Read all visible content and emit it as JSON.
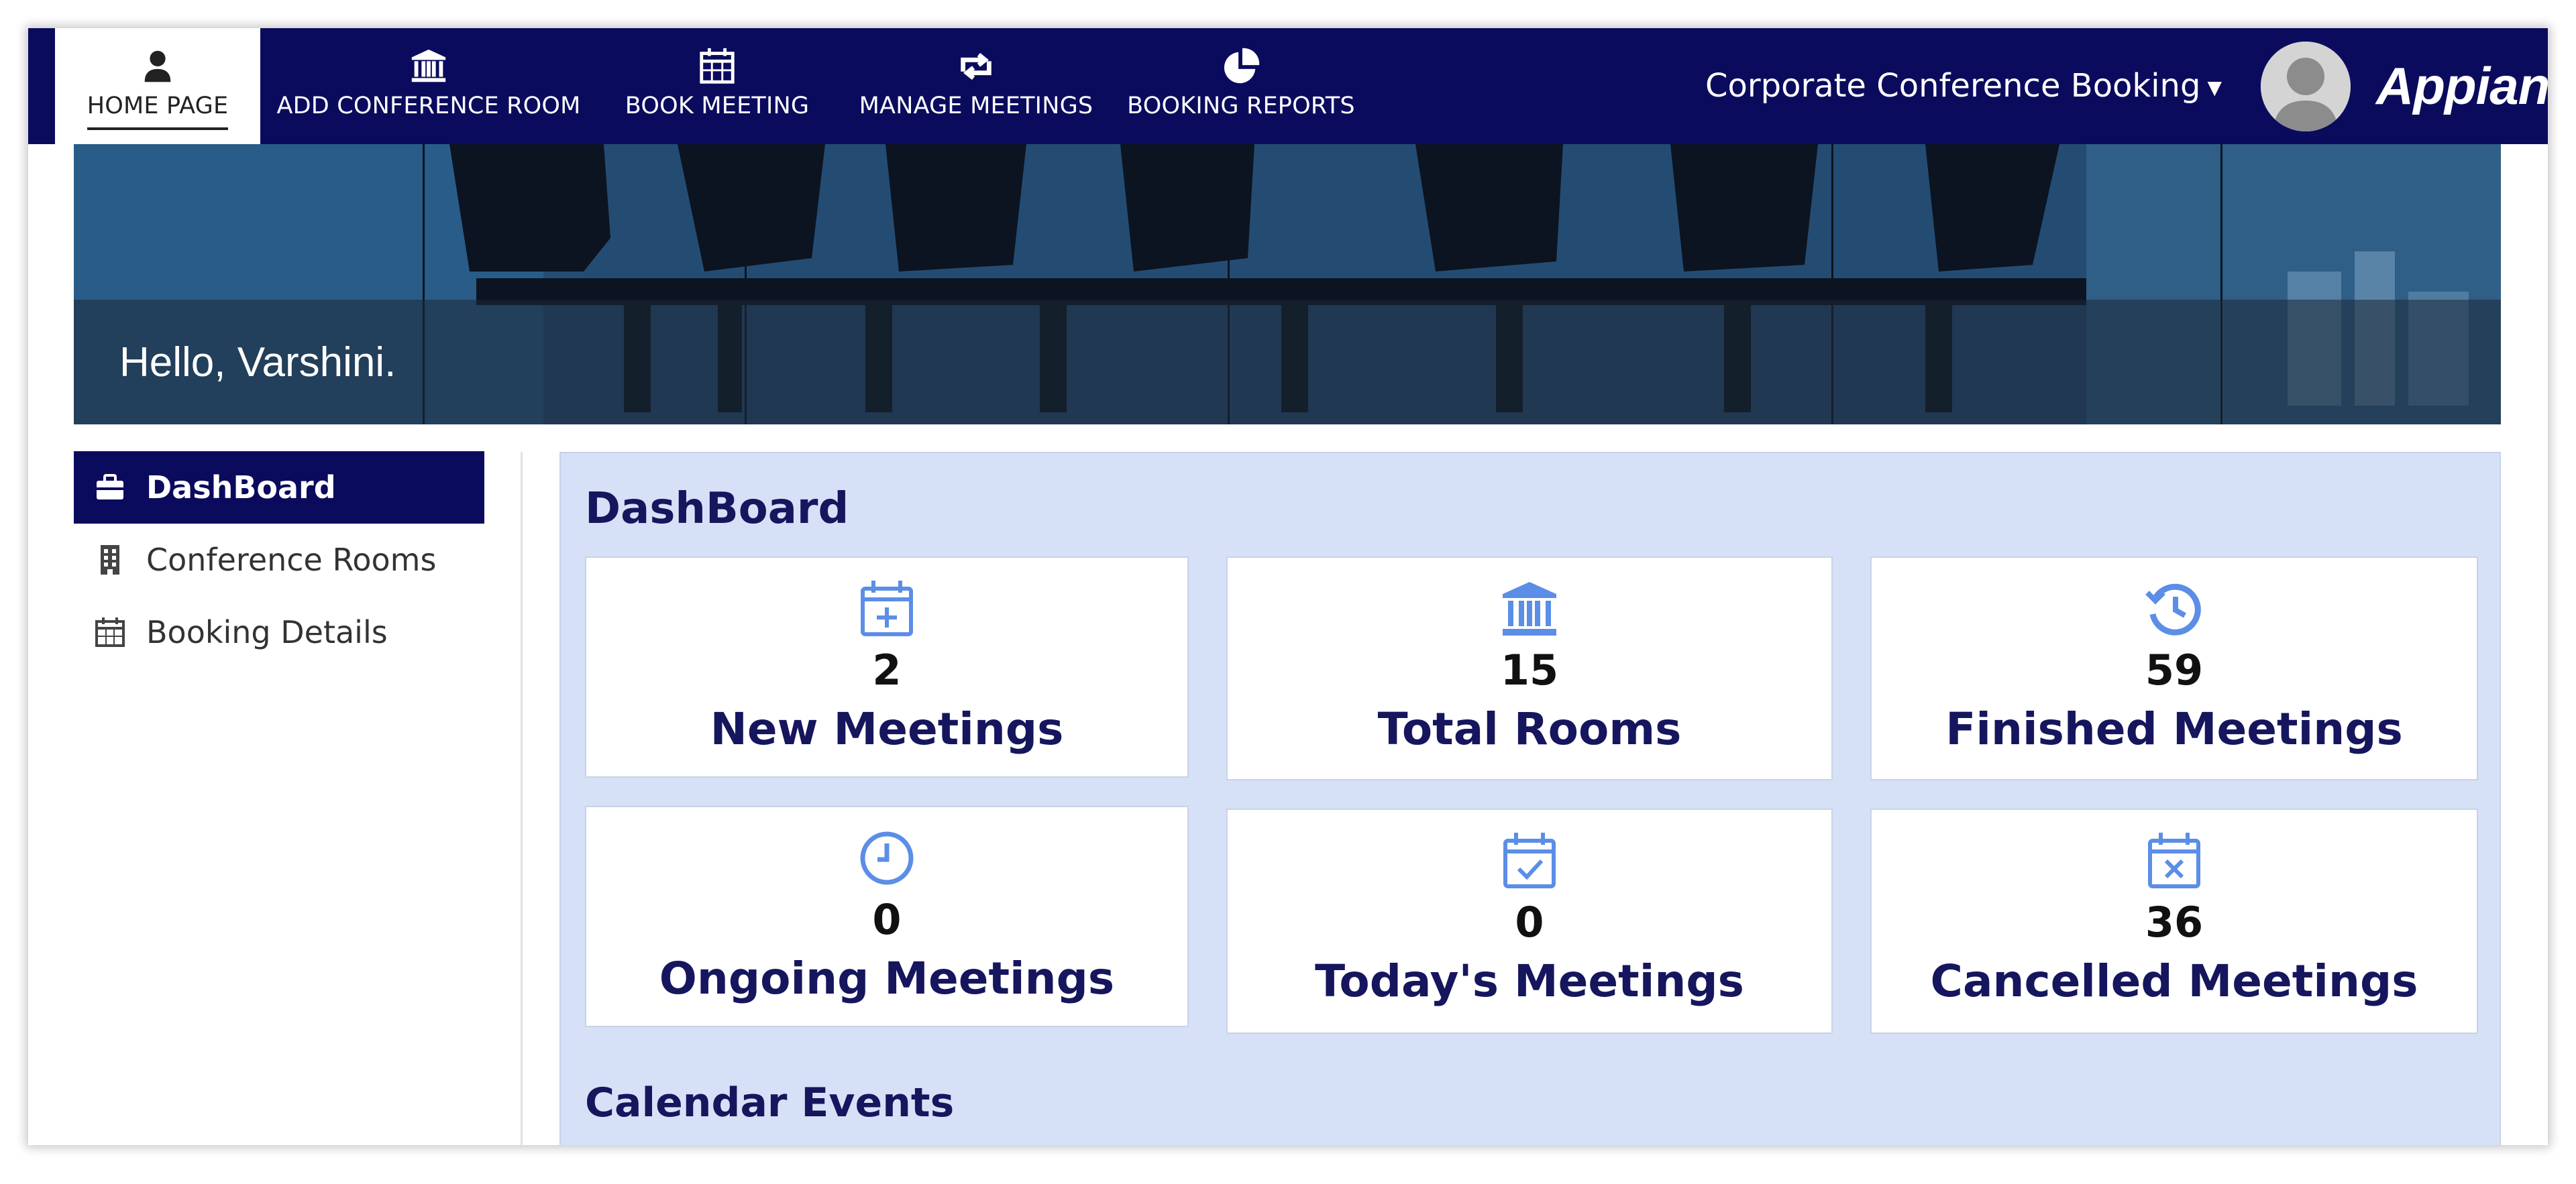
{
  "nav": {
    "tabs": [
      {
        "label": "HOME PAGE",
        "icon": "user-icon",
        "active": true
      },
      {
        "label": "ADD CONFERENCE ROOM",
        "icon": "bank-icon"
      },
      {
        "label": "BOOK MEETING",
        "icon": "calendar-icon"
      },
      {
        "label": "MANAGE MEETINGS",
        "icon": "retweet-icon"
      },
      {
        "label": "BOOKING REPORTS",
        "icon": "pie-chart-icon"
      }
    ],
    "app_name": "Corporate Conference Booking",
    "logo_text": "Appian"
  },
  "banner": {
    "greeting": "Hello, Varshini."
  },
  "sidebar": {
    "items": [
      {
        "label": "DashBoard",
        "icon": "briefcase-icon",
        "active": true
      },
      {
        "label": "Conference Rooms",
        "icon": "building-icon"
      },
      {
        "label": "Booking Details",
        "icon": "calendar-icon"
      }
    ]
  },
  "dashboard": {
    "title": "DashBoard",
    "cards": [
      {
        "value": "2",
        "label": "New Meetings",
        "icon": "calendar-plus-icon"
      },
      {
        "value": "15",
        "label": "Total Rooms",
        "icon": "bank-icon"
      },
      {
        "value": "59",
        "label": "Finished Meetings",
        "icon": "history-icon"
      },
      {
        "value": "0",
        "label": "Ongoing Meetings",
        "icon": "clock-icon"
      },
      {
        "value": "0",
        "label": "Today's Meetings",
        "icon": "calendar-check-icon"
      },
      {
        "value": "36",
        "label": "Cancelled Meetings",
        "icon": "calendar-x-icon"
      }
    ],
    "calendar_title": "Calendar Events"
  },
  "colors": {
    "nav_bg": "#0b0b5e",
    "dashboard_bg": "#d6e1f7",
    "card_icon": "#5b8ee6",
    "heading": "#16165e"
  }
}
